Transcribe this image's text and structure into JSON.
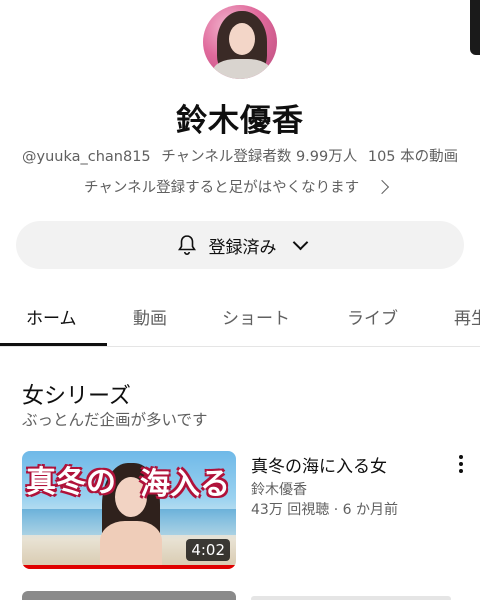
{
  "channel": {
    "name": "鈴木優香",
    "handle": "@yuuka_chan815",
    "subscribers": "チャンネル登録者数 9.99万人",
    "video_count": "105 本の動画",
    "subtext": "チャンネル登録すると足がはやくなります"
  },
  "subscribe_button": {
    "label": "登録済み",
    "icon": "bell-icon"
  },
  "tabs": [
    {
      "label": "ホーム",
      "active": true
    },
    {
      "label": "動画",
      "active": false
    },
    {
      "label": "ショート",
      "active": false
    },
    {
      "label": "ライブ",
      "active": false
    },
    {
      "label": "再生",
      "active": false
    }
  ],
  "section": {
    "title": "女シリーズ",
    "subtitle": "ぶっとんだ企画が多いです"
  },
  "videos": [
    {
      "title": "真冬の海に入る女",
      "channel": "鈴木優香",
      "meta": "43万 回視聴 · 6 か月前",
      "duration": "4:02",
      "thumb_text_left": "真冬の",
      "thumb_text_right": "海入る"
    }
  ],
  "colors": {
    "accent": "#e00000",
    "text": "#0f0f0f",
    "secondary": "#606060"
  }
}
